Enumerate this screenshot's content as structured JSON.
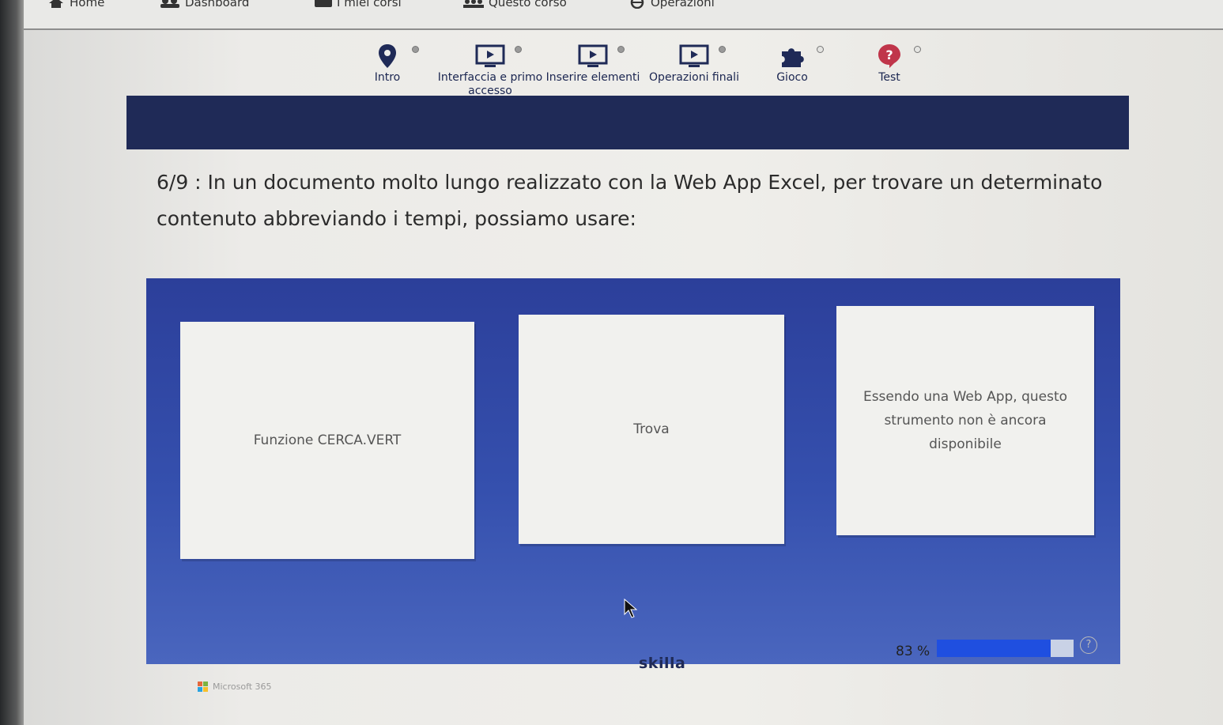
{
  "topnav": {
    "items": [
      {
        "label": "Home",
        "icon": "home-icon"
      },
      {
        "label": "Dashboard",
        "icon": "users-icon"
      },
      {
        "label": "I miei corsi",
        "icon": "folder-icon"
      },
      {
        "label": "Questo corso",
        "icon": "group-icon"
      },
      {
        "label": "Operazioni",
        "icon": "globe-icon"
      }
    ]
  },
  "steps": [
    {
      "label": "Intro",
      "icon": "location-pin-icon"
    },
    {
      "label": "Interfaccia e primo accesso",
      "icon": "video-play-icon"
    },
    {
      "label": "Inserire elementi",
      "icon": "video-play-icon"
    },
    {
      "label": "Operazioni finali",
      "icon": "video-play-icon"
    },
    {
      "label": "Gioco",
      "icon": "puzzle-icon"
    },
    {
      "label": "Test",
      "icon": "question-icon"
    }
  ],
  "active_step": "Test",
  "question": {
    "text": "6/9 : In un documento molto lungo realizzato con la Web App Excel, per trovare un determinato contenuto abbreviando i tempi, possiamo usare:"
  },
  "answers": [
    {
      "text": "Funzione CERCA.VERT"
    },
    {
      "text": "Trova"
    },
    {
      "text": "Essendo una Web App, questo strumento non è ancora disponibile"
    }
  ],
  "footer": {
    "brand": "skilla",
    "progress_text": "83 %",
    "progress_value": 0.83,
    "ms_label": "Microsoft 365"
  },
  "colors": {
    "primary": "#1f2a57",
    "accent": "#b83246",
    "panel": "#3550ae",
    "progress": "#1f4fe0"
  }
}
